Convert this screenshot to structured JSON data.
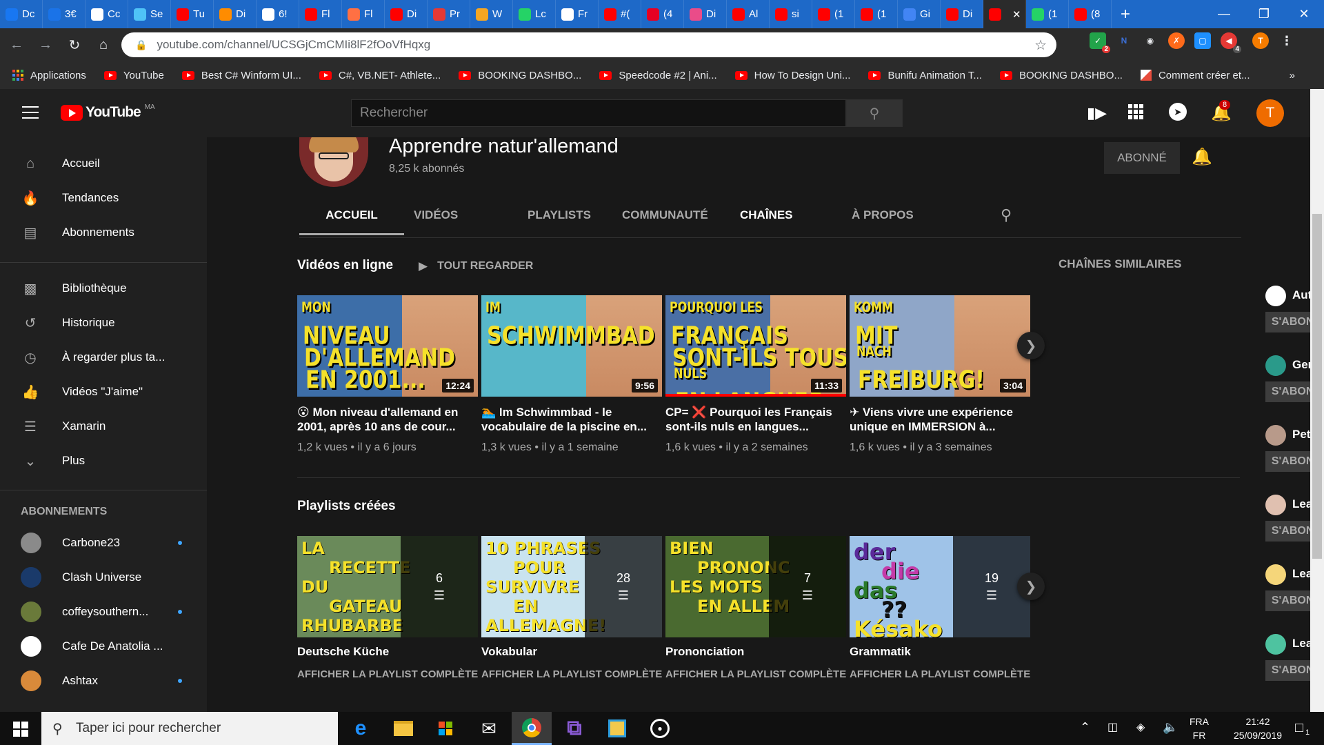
{
  "browser": {
    "tabs": [
      {
        "label": "Dc",
        "color": "#1877f2"
      },
      {
        "label": "3€",
        "color": "#1a73e8"
      },
      {
        "label": "Cc",
        "color": "#ffffff"
      },
      {
        "label": "Se",
        "color": "#4fc3f7"
      },
      {
        "label": "Tu",
        "color": "#ff0000"
      },
      {
        "label": "Di",
        "color": "#ff8c00"
      },
      {
        "label": "6!",
        "color": "#ffffff"
      },
      {
        "label": "Fl",
        "color": "#ff0000"
      },
      {
        "label": "Fl",
        "color": "#ff7043"
      },
      {
        "label": "Di",
        "color": "#ff0000"
      },
      {
        "label": "Pr",
        "color": "#e53935"
      },
      {
        "label": "W",
        "color": "#f5a623"
      },
      {
        "label": "Lc",
        "color": "#25d366"
      },
      {
        "label": "Fr",
        "color": "#ffffff"
      },
      {
        "label": "#(",
        "color": "#ff0000"
      },
      {
        "label": "(4",
        "color": "#e60023"
      },
      {
        "label": "Di",
        "color": "#ea4c89"
      },
      {
        "label": "Al",
        "color": "#ff0000"
      },
      {
        "label": "si",
        "color": "#ff0000"
      },
      {
        "label": "(1",
        "color": "#ff0000"
      },
      {
        "label": "(1",
        "color": "#ff0000"
      },
      {
        "label": "Gi",
        "color": "#4285f4"
      },
      {
        "label": "Di",
        "color": "#ff0000"
      },
      {
        "label": "",
        "color": "#ff0000"
      },
      {
        "label": "(1",
        "color": "#25d366"
      },
      {
        "label": "(8",
        "color": "#ff0000"
      }
    ],
    "active_tab_close": "✕",
    "new_tab": "+",
    "url": "youtube.com/channel/UCSGjCmCMIi8lF2fOoVfHqxg",
    "bookmarks": [
      {
        "label": "Applications",
        "type": "apps"
      },
      {
        "label": "YouTube",
        "type": "yt"
      },
      {
        "label": "Best C# Winform UI...",
        "type": "yt"
      },
      {
        "label": "C#, VB.NET- Athlete...",
        "type": "yt"
      },
      {
        "label": "BOOKING DASHBO...",
        "type": "yt"
      },
      {
        "label": "Speedcode #2 | Ani...",
        "type": "yt"
      },
      {
        "label": "How To Design Uni...",
        "type": "yt"
      },
      {
        "label": "Bunifu Animation T...",
        "type": "yt"
      },
      {
        "label": "BOOKING DASHBO...",
        "type": "yt"
      },
      {
        "label": "Comment créer et...",
        "type": "other"
      }
    ],
    "more_bookmarks": "»",
    "ext_badges": {
      "ext1": "2",
      "ext2": "4"
    },
    "profile_initial": "T"
  },
  "masthead": {
    "logo_text": "YouTube",
    "region": "MA",
    "search_placeholder": "Rechercher",
    "notif_count": "8",
    "avatar_initial": "T"
  },
  "sidebar": {
    "primary": [
      {
        "label": "Accueil",
        "icon": "home-icon"
      },
      {
        "label": "Tendances",
        "icon": "trending-icon"
      },
      {
        "label": "Abonnements",
        "icon": "subscriptions-icon"
      }
    ],
    "library": [
      {
        "label": "Bibliothèque",
        "icon": "library-icon"
      },
      {
        "label": "Historique",
        "icon": "history-icon"
      },
      {
        "label": "À regarder plus ta...",
        "icon": "watch-later-icon"
      },
      {
        "label": "Vidéos \"J'aime\"",
        "icon": "like-icon"
      },
      {
        "label": "Xamarin",
        "icon": "playlist-icon"
      },
      {
        "label": "Plus",
        "icon": "chevron-down-icon"
      }
    ],
    "subscriptions_header": "ABONNEMENTS",
    "subscriptions": [
      {
        "label": "Carbone23",
        "dot": true,
        "color": "#8a8a8a"
      },
      {
        "label": "Clash Universe",
        "dot": false,
        "color": "#1a3a6a"
      },
      {
        "label": "coffeysouthern...",
        "dot": true,
        "color": "#6a7a3a"
      },
      {
        "label": "Cafe De Anatolia ...",
        "dot": false,
        "color": "#ffffff"
      },
      {
        "label": "Ashtax",
        "dot": true,
        "color": "#d98a3a"
      }
    ]
  },
  "channel": {
    "name": "Apprendre natur'allemand",
    "subscribers": "8,25 k abonnés",
    "subscribed_label": "ABONNÉ",
    "tabs": [
      "ACCUEIL",
      "VIDÉOS",
      "PLAYLISTS",
      "COMMUNAUTÉ",
      "CHAÎNES",
      "À PROPOS"
    ],
    "active_tab": "ACCUEIL"
  },
  "uploads": {
    "title": "Vidéos en ligne",
    "play_all": "TOUT REGARDER",
    "videos": [
      {
        "title": "😮 Mon niveau d'allemand en 2001, après 10 ans de cour...",
        "views": "1,2 k vues",
        "age": "il y a 6 jours",
        "duration": "12:24",
        "thumb": [
          "MON",
          "NIVEAU",
          "D'ALLEMAND",
          "EN 2001..."
        ],
        "bg": "#3d6ea8"
      },
      {
        "title": "🏊 Im Schwimmbad - le vocabulaire de la piscine en...",
        "views": "1,3 k vues",
        "age": "il y a 1 semaine",
        "duration": "9:56",
        "thumb": [
          "IM",
          "SCHWIMMBAD"
        ],
        "bg": "#57b7c9"
      },
      {
        "title": "CP= ❌ Pourquoi les Français sont-ils nuls en langues...",
        "views": "1,6 k vues",
        "age": "il y a 2 semaines",
        "duration": "11:33",
        "thumb": [
          "POURQUOI LES",
          "FRANÇAIS",
          "SONT-ILS TOUS",
          "NULS",
          "EN LANGUES"
        ],
        "bg": "#4a6fa5"
      },
      {
        "title": "✈ Viens vivre une expérience unique en IMMERSION à...",
        "views": "1,6 k vues",
        "age": "il y a 3 semaines",
        "duration": "3:04",
        "thumb": [
          "KOMM",
          "MIT",
          "NACH",
          "FREIBURG!"
        ],
        "bg": "#8fa6c8"
      }
    ]
  },
  "playlists": {
    "title": "Playlists créées",
    "link_label": "AFFICHER LA PLAYLIST COMPLÈTE",
    "items": [
      {
        "title": "Deutsche Küche",
        "count": "6",
        "thumb": [
          "LA",
          "RECETTE",
          "DU",
          "GATEAU",
          "RHUBARBE"
        ],
        "bg": "#6a8a5a"
      },
      {
        "title": "Vokabular",
        "count": "28",
        "thumb": [
          "10 PHRASES",
          "POUR",
          "SURVIVRE",
          "EN",
          "ALLEMAGNE!"
        ],
        "bg": "#c9e3ef"
      },
      {
        "title": "Prononciation",
        "count": "7",
        "thumb": [
          "BIEN",
          "PRONONCER",
          "LES MOTS",
          "EN ALLEMAND"
        ],
        "bg": "#4a6a30"
      },
      {
        "title": "Grammatik",
        "count": "19",
        "thumb": [
          "der",
          "die",
          "das",
          "??",
          "Késako"
        ],
        "bg": "#9fc3e8"
      }
    ]
  },
  "similar": {
    "title": "CHAÎNES SIMILAIRES",
    "subscribe_label": "S'ABONNER",
    "channels": [
      {
        "name": "Authentic German Lear...",
        "color": "#ffffff"
      },
      {
        "name": "GermanSkills.com",
        "color": "#2a9a8a"
      },
      {
        "name": "Peter Heinrich",
        "color": "#b89a8a"
      },
      {
        "name": "Learn German - Deutsc...",
        "color": "#e0c0b0"
      },
      {
        "name": "Learn German with Anja",
        "color": "#f5d67a"
      },
      {
        "name": "Learn German with Jen...",
        "color": "#4ec3a0"
      }
    ]
  },
  "taskbar": {
    "search_placeholder": "Taper ici pour rechercher",
    "lang_top": "FRA",
    "lang_bottom": "FR",
    "time": "21:42",
    "date": "25/09/2019",
    "notif_count": "1"
  }
}
